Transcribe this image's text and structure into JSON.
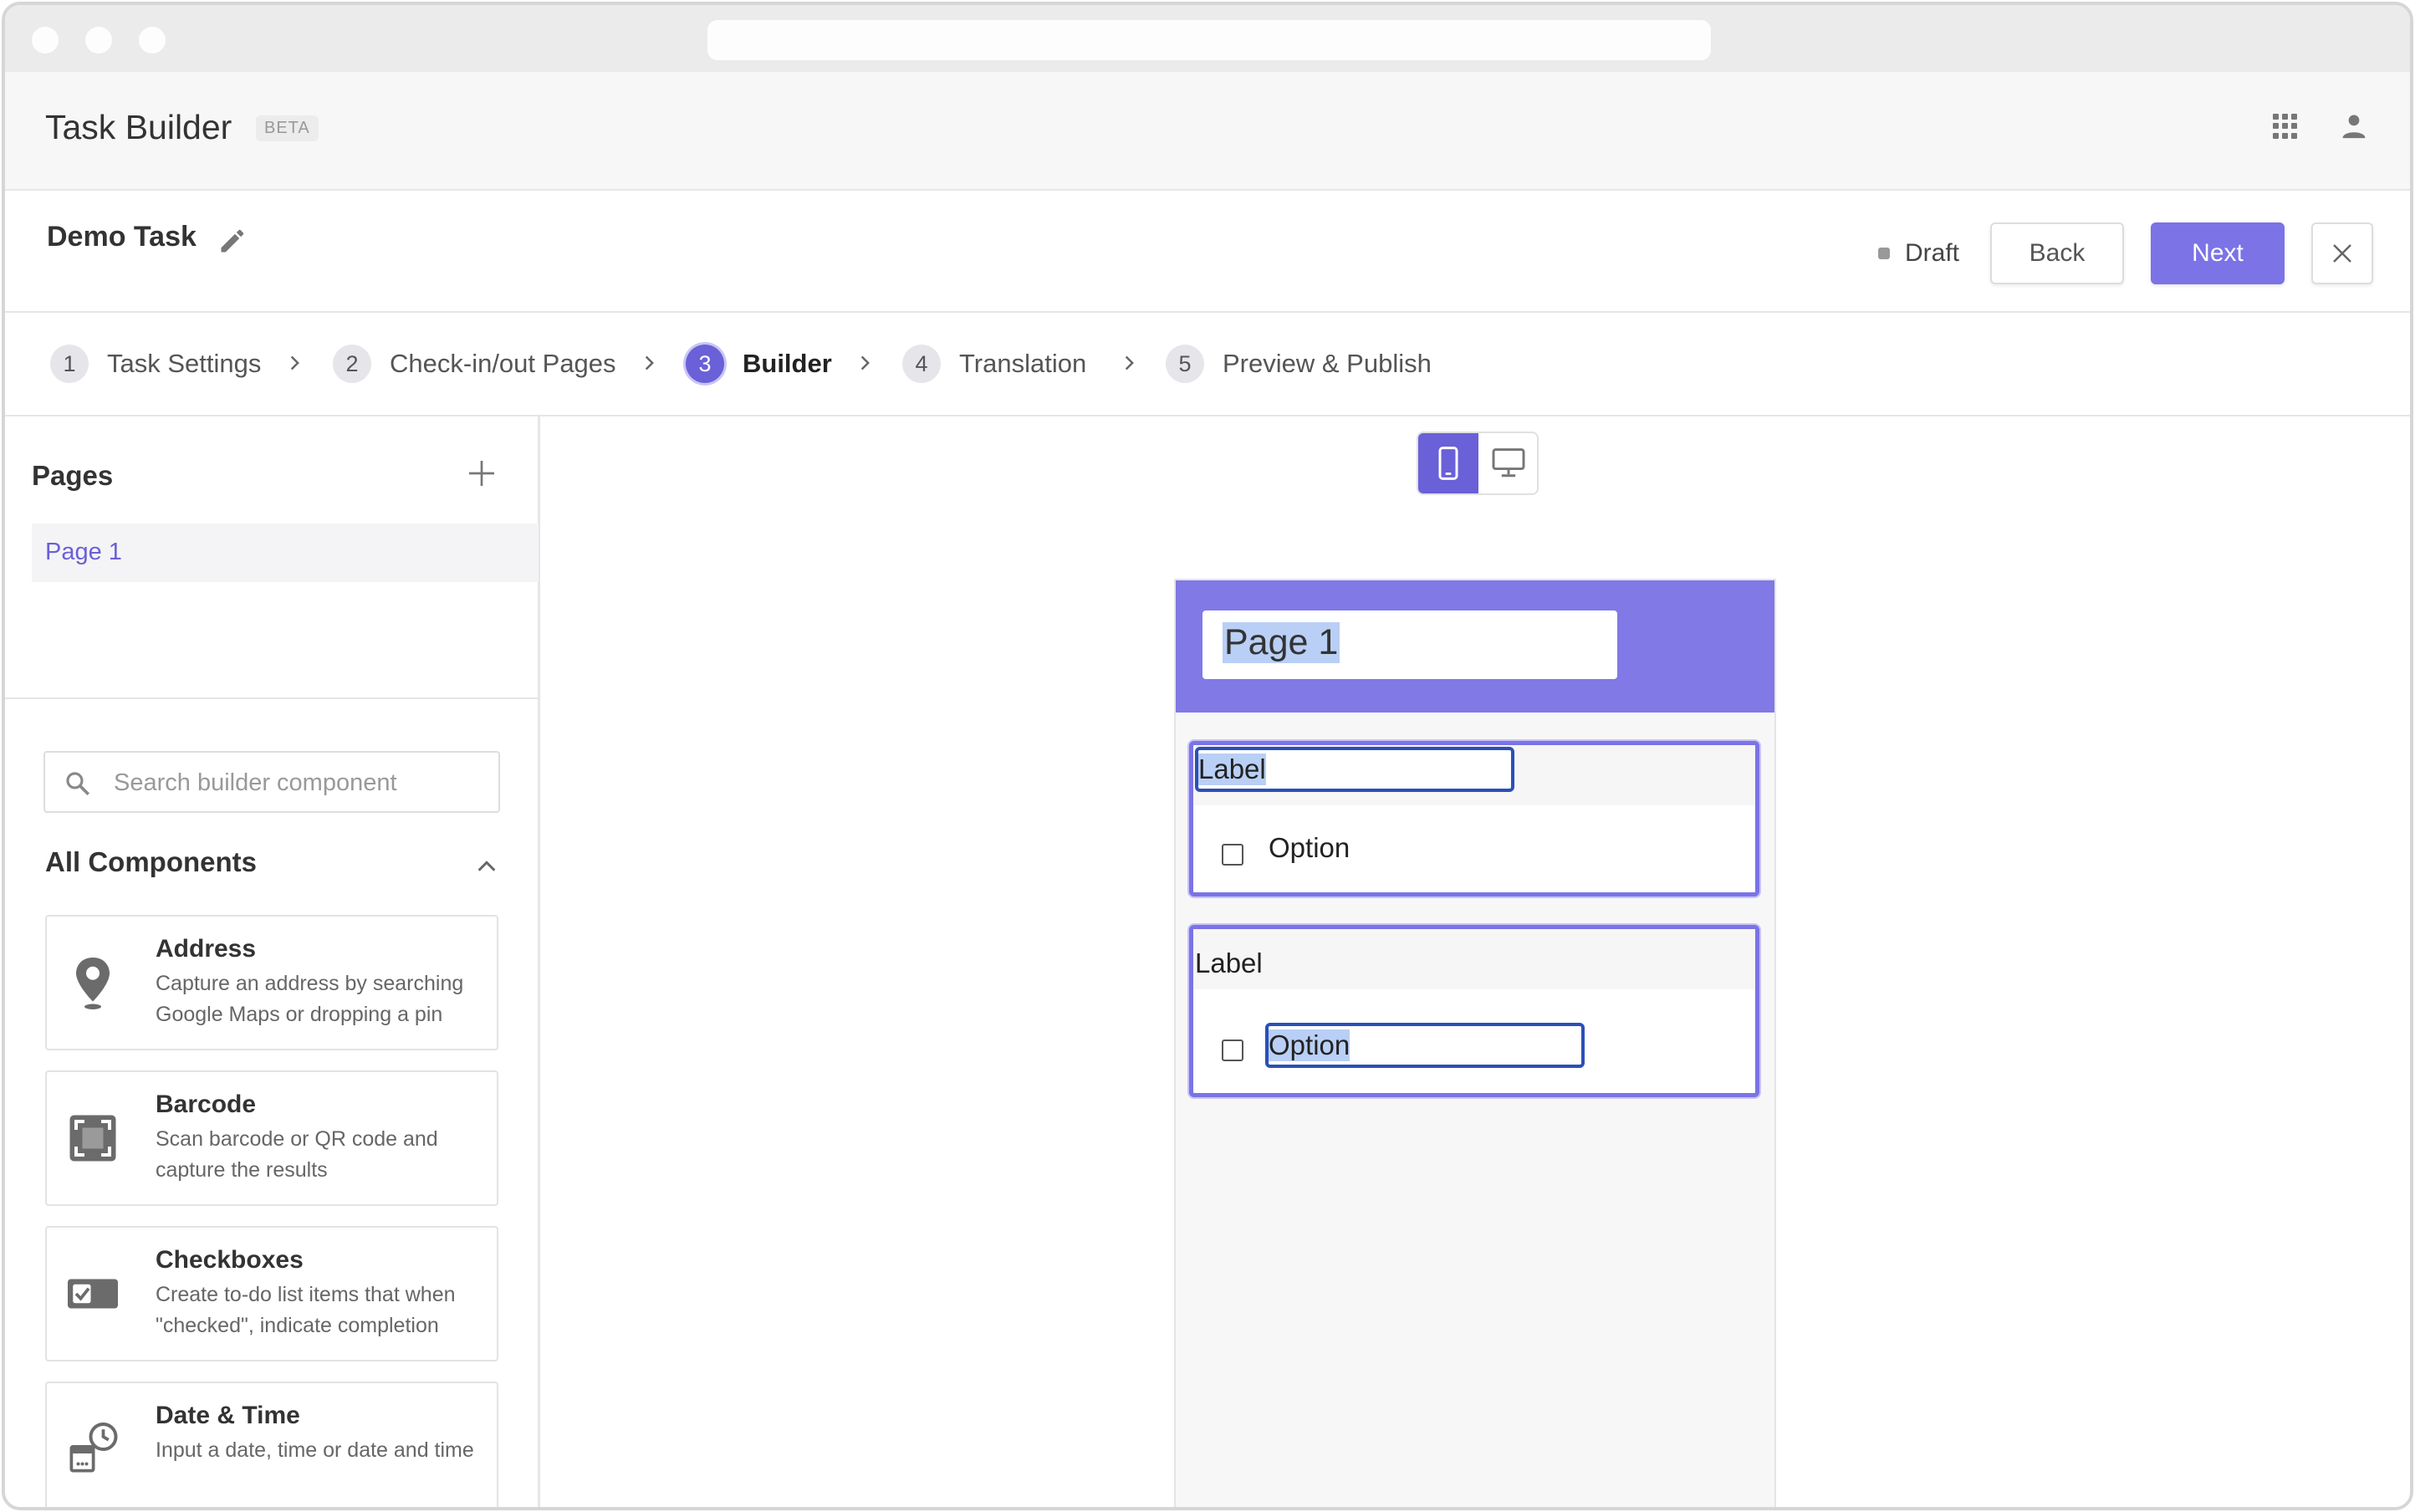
{
  "app": {
    "title": "Task Builder",
    "badge": "BETA"
  },
  "task": {
    "name": "Demo Task",
    "status": "Draft"
  },
  "actions": {
    "back": "Back",
    "next": "Next"
  },
  "steps": [
    {
      "num": "1",
      "label": "Task Settings"
    },
    {
      "num": "2",
      "label": "Check-in/out Pages"
    },
    {
      "num": "3",
      "label": "Builder"
    },
    {
      "num": "4",
      "label": "Translation"
    },
    {
      "num": "5",
      "label": "Preview & Publish"
    }
  ],
  "sidebar": {
    "pages_title": "Pages",
    "pages": [
      "Page 1"
    ],
    "search_placeholder": "Search builder component",
    "components_title": "All Components",
    "components": [
      {
        "title": "Address",
        "desc": "Capture an address by searching Google Maps or dropping a pin",
        "icon": "map-pin-icon"
      },
      {
        "title": "Barcode",
        "desc": "Scan barcode or QR code and capture the results",
        "icon": "barcode-icon"
      },
      {
        "title": "Checkboxes",
        "desc": "Create to-do list items that when \"checked\", indicate completion",
        "icon": "checkbox-icon"
      },
      {
        "title": "Date & Time",
        "desc": "Input a date, time or date and time",
        "icon": "calendar-clock-icon"
      }
    ]
  },
  "preview": {
    "page_title": "Page 1",
    "fields": [
      {
        "label": "Label",
        "option": "Option"
      },
      {
        "label": "Label",
        "option": "Option"
      }
    ]
  },
  "colors": {
    "accent": "#6a60d8",
    "header": "#8079e6",
    "selection": "#b9cff5",
    "edit_border": "#2a50b8"
  }
}
